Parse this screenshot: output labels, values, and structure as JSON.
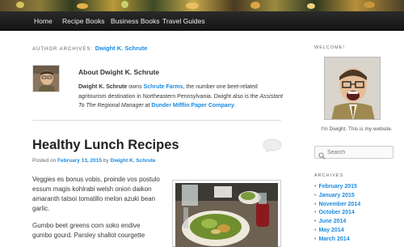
{
  "nav": {
    "items": [
      "Home",
      "Recipe Books",
      "Business Books",
      "Travel Guides"
    ]
  },
  "archive_header": {
    "label": "AUTHOR ARCHIVES:",
    "author": "Dwight K. Schrute"
  },
  "author_box": {
    "title": "About Dwight K. Schrute",
    "bio_name": "Dwight K. Schrute",
    "bio_text1": " owns ",
    "bio_link1": "Schrute Farms",
    "bio_text2": ", the number one beet-related agritourism destination in Northeastern Pennsylvania. Dwight also is the ",
    "bio_italic": "Assistant To The Regional Manager",
    "bio_text3": " at ",
    "bio_link2": "Dunder Mifflin Paper Company",
    "bio_text4": "."
  },
  "post": {
    "title": "Healthy Lunch Recipes",
    "meta_prefix": "Posted on ",
    "date": "February 13, 2015",
    "meta_by": " by ",
    "author": "Dwight K. Schrute",
    "paragraph1": "Veggies es bonus vobis, proinde vos postulo essum magis kohlrabi welsh onion daikon amaranth tatsoi tomatillo melon azuki bean garlic.",
    "paragraph2": "Gumbo beet greens corn soko endive gumbo gourd. Parsley shallot courgette"
  },
  "sidebar": {
    "welcome_heading": "WELCOME!",
    "caption": "I'm Dwight. This is my website.",
    "search_placeholder": "Search",
    "archives_heading": "ARCHIVES",
    "archives": [
      "February 2015",
      "January 2015",
      "November 2014",
      "October 2014",
      "June 2014",
      "May 2014",
      "March 2014"
    ]
  },
  "colors": {
    "link": "#1b8be0",
    "nav_bg": "#1e1e1e"
  }
}
